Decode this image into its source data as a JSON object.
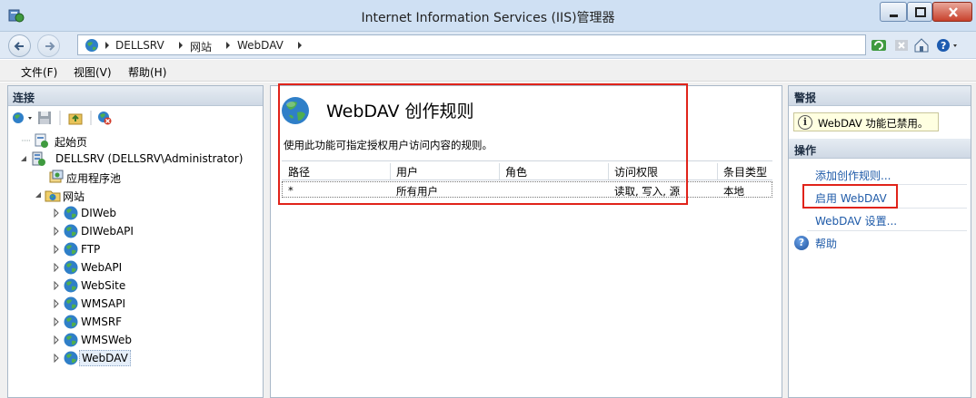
{
  "window": {
    "title": "Internet Information Services (IIS)管理器",
    "icon": "iis-manager-icon"
  },
  "address": {
    "crumbs": [
      "DELLSRV",
      "网站",
      "WebDAV"
    ]
  },
  "menu": {
    "items": [
      "文件(F)",
      "视图(V)",
      "帮助(H)"
    ]
  },
  "connections": {
    "header": "连接",
    "tree": [
      {
        "label": "起始页",
        "icon": "start-page-icon"
      },
      {
        "label": "DELLSRV (DELLSRV\\Administrator)",
        "icon": "server-icon"
      },
      {
        "label": "应用程序池",
        "icon": "app-pool-icon"
      },
      {
        "label": "网站",
        "icon": "sites-folder-icon"
      },
      {
        "label": "DIWeb",
        "icon": "globe-icon"
      },
      {
        "label": "DIWebAPI",
        "icon": "globe-icon"
      },
      {
        "label": "FTP",
        "icon": "globe-icon"
      },
      {
        "label": "WebAPI",
        "icon": "globe-icon"
      },
      {
        "label": "WebSite",
        "icon": "globe-icon"
      },
      {
        "label": "WMSAPI",
        "icon": "globe-icon"
      },
      {
        "label": "WMSRF",
        "icon": "globe-icon"
      },
      {
        "label": "WMSWeb",
        "icon": "globe-icon"
      },
      {
        "label": "WebDAV",
        "icon": "globe-icon"
      }
    ]
  },
  "feature": {
    "title": "WebDAV 创作规则",
    "description": "使用此功能可指定授权用户访问内容的规则。",
    "columns": [
      "路径",
      "用户",
      "角色",
      "访问权限",
      "条目类型"
    ],
    "rows": [
      {
        "path": "*",
        "user": "所有用户",
        "role": "",
        "access": "读取, 写入, 源",
        "entry_type": "本地"
      }
    ]
  },
  "actions": {
    "alerts_header": "警报",
    "alert_text": "WebDAV 功能已禁用。",
    "actions_header": "操作",
    "items": [
      "添加创作规则...",
      "启用 WebDAV",
      "WebDAV 设置...",
      "帮助"
    ]
  },
  "colors": {
    "highlight_border": "#e0231a",
    "link": "#1e5aa8",
    "alert_bg": "#ffffe1"
  }
}
